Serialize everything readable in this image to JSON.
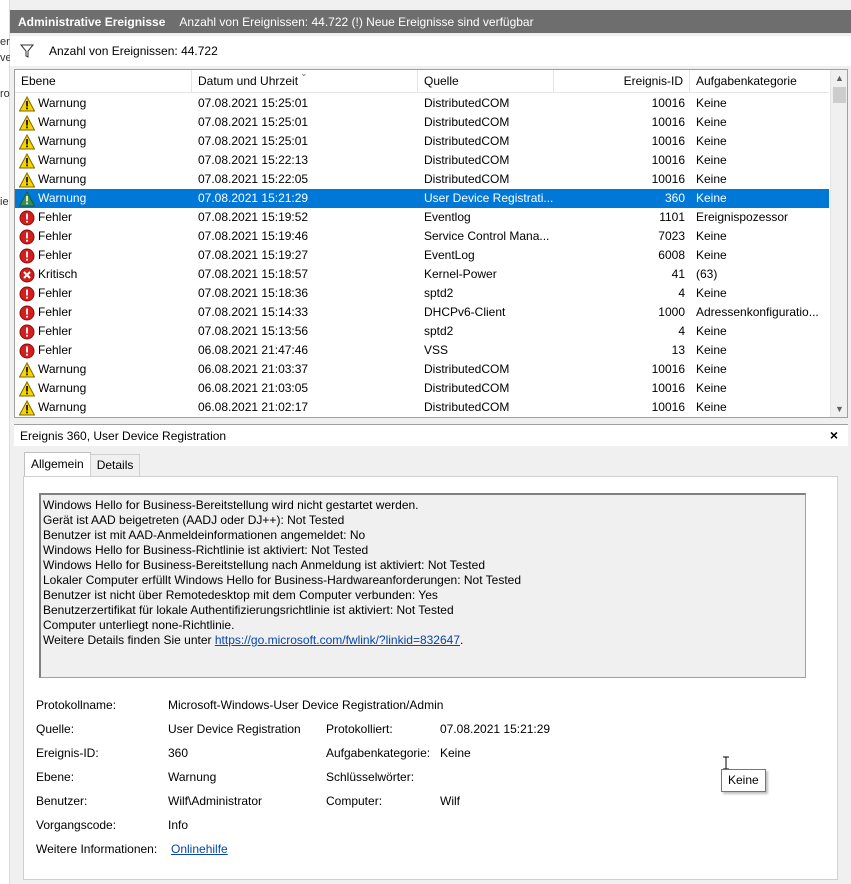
{
  "left_strip": [
    "er",
    "ve",
    "ro",
    "ie"
  ],
  "titlebar": {
    "title": "Administrative Ereignisse",
    "info": "Anzahl von Ereignissen: 44.722 (!) Neue Ereignisse sind verfügbar"
  },
  "filterbar": {
    "text": "Anzahl von Ereignissen: 44.722",
    "icon": "filter-icon"
  },
  "table": {
    "columns": [
      "Ebene",
      "Datum und Uhrzeit",
      "Quelle",
      "Ereignis-ID",
      "Aufgabenkategorie"
    ],
    "rows": [
      {
        "level": "Warnung",
        "icon": "warning",
        "date": "07.08.2021 15:25:01",
        "source": "DistributedCOM",
        "id": "10016",
        "category": "Keine"
      },
      {
        "level": "Warnung",
        "icon": "warning",
        "date": "07.08.2021 15:25:01",
        "source": "DistributedCOM",
        "id": "10016",
        "category": "Keine"
      },
      {
        "level": "Warnung",
        "icon": "warning",
        "date": "07.08.2021 15:25:01",
        "source": "DistributedCOM",
        "id": "10016",
        "category": "Keine"
      },
      {
        "level": "Warnung",
        "icon": "warning",
        "date": "07.08.2021 15:22:13",
        "source": "DistributedCOM",
        "id": "10016",
        "category": "Keine"
      },
      {
        "level": "Warnung",
        "icon": "warning",
        "date": "07.08.2021 15:22:05",
        "source": "DistributedCOM",
        "id": "10016",
        "category": "Keine"
      },
      {
        "level": "Warnung",
        "icon": "warning",
        "date": "07.08.2021 15:21:29",
        "source": "User Device Registrati...",
        "id": "360",
        "category": "Keine",
        "selected": true
      },
      {
        "level": "Fehler",
        "icon": "error",
        "date": "07.08.2021 15:19:52",
        "source": "Eventlog",
        "id": "1101",
        "category": "Ereignispozessor"
      },
      {
        "level": "Fehler",
        "icon": "error",
        "date": "07.08.2021 15:19:46",
        "source": "Service Control Mana...",
        "id": "7023",
        "category": "Keine"
      },
      {
        "level": "Fehler",
        "icon": "error",
        "date": "07.08.2021 15:19:27",
        "source": "EventLog",
        "id": "6008",
        "category": "Keine"
      },
      {
        "level": "Kritisch",
        "icon": "critical",
        "date": "07.08.2021 15:18:57",
        "source": "Kernel-Power",
        "id": "41",
        "category": "(63)"
      },
      {
        "level": "Fehler",
        "icon": "error",
        "date": "07.08.2021 15:18:36",
        "source": "sptd2",
        "id": "4",
        "category": "Keine"
      },
      {
        "level": "Fehler",
        "icon": "error",
        "date": "07.08.2021 15:14:33",
        "source": "DHCPv6-Client",
        "id": "1000",
        "category": "Adressenkonfiguratio..."
      },
      {
        "level": "Fehler",
        "icon": "error",
        "date": "07.08.2021 15:13:56",
        "source": "sptd2",
        "id": "4",
        "category": "Keine"
      },
      {
        "level": "Fehler",
        "icon": "error",
        "date": "06.08.2021 21:47:46",
        "source": "VSS",
        "id": "13",
        "category": "Keine"
      },
      {
        "level": "Warnung",
        "icon": "warning",
        "date": "06.08.2021 21:03:37",
        "source": "DistributedCOM",
        "id": "10016",
        "category": "Keine"
      },
      {
        "level": "Warnung",
        "icon": "warning",
        "date": "06.08.2021 21:03:05",
        "source": "DistributedCOM",
        "id": "10016",
        "category": "Keine"
      },
      {
        "level": "Warnung",
        "icon": "warning",
        "date": "06.08.2021 21:02:17",
        "source": "DistributedCOM",
        "id": "10016",
        "category": "Keine"
      }
    ]
  },
  "detail": {
    "header": "Ereignis 360, User Device Registration",
    "close": "×",
    "tabs": [
      "Allgemein",
      "Details"
    ],
    "description": [
      "Windows Hello for Business-Bereitstellung wird nicht gestartet werden.",
      "Gerät ist AAD beigetreten (AADJ oder DJ++): Not Tested",
      "Benutzer ist mit AAD-Anmeldeinformationen angemeldet: No",
      "Windows Hello for Business-Richtlinie ist aktiviert: Not Tested",
      "Windows Hello for Business-Bereitstellung nach Anmeldung ist aktiviert: Not Tested",
      "Lokaler Computer erfüllt Windows Hello for Business-Hardwareanforderungen: Not Tested",
      "Benutzer ist nicht über Remotedesktop mit dem Computer verbunden: Yes",
      "Benutzerzertifikat für lokale Authentifizierungsrichtlinie ist aktiviert: Not Tested",
      "Computer unterliegt none-Richtlinie."
    ],
    "details_prefix": "Weitere Details finden Sie unter ",
    "details_link": "https://go.microsoft.com/fwlink/?linkid=832647",
    "details_suffix": ".",
    "props": {
      "protokollname_label": "Protokollname:",
      "protokollname": "Microsoft-Windows-User Device Registration/Admin",
      "quelle_label": "Quelle:",
      "quelle": "User Device Registration",
      "protokolliert_label": "Protokolliert:",
      "protokolliert": "07.08.2021 15:21:29",
      "ereignisid_label": "Ereignis-ID:",
      "ereignisid": "360",
      "aufgabenkategorie_label": "Aufgabenkategorie:",
      "aufgabenkategorie": "Keine",
      "ebene_label": "Ebene:",
      "ebene": "Warnung",
      "schluesselwoerter_label": "Schlüsselwörter:",
      "benutzer_label": "Benutzer:",
      "benutzer": "Wilf\\Administrator",
      "computer_label": "Computer:",
      "computer": "Wilf",
      "vorgangscode_label": "Vorgangscode:",
      "vorgangscode": "Info",
      "weitere_label": "Weitere Informationen:",
      "weitere_link": "Onlinehilfe"
    }
  },
  "tooltip": "Keine",
  "colors": {
    "selected_row": "#0078d7",
    "titlebar": "#6e6e6e",
    "link": "#0645ad"
  }
}
